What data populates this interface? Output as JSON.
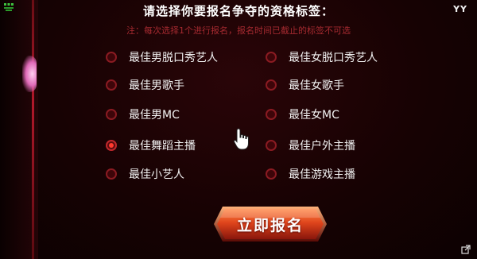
{
  "window": {
    "logo": "YY"
  },
  "form": {
    "title": "请选择你要报名争夺的资格标签：",
    "note": "注：每次选择1个进行报名，报名时间已截止的标签不可选",
    "options": [
      {
        "label": "最佳男脱口秀艺人",
        "selected": false
      },
      {
        "label": "最佳女脱口秀艺人",
        "selected": false
      },
      {
        "label": "最佳男歌手",
        "selected": false
      },
      {
        "label": "最佳女歌手",
        "selected": false
      },
      {
        "label": "最佳男MC",
        "selected": false
      },
      {
        "label": "最佳女MC",
        "selected": false
      },
      {
        "label": "最佳舞蹈主播",
        "selected": true
      },
      {
        "label": "最佳户外主播",
        "selected": false
      },
      {
        "label": "最佳小艺人",
        "selected": false
      },
      {
        "label": "最佳游戏主播",
        "selected": false
      }
    ],
    "submit_label": "立即报名"
  },
  "icons": {
    "top_left": "app-menu-icon",
    "cursor": "hand-pointer-icon",
    "bottom_right": "external-link-icon"
  },
  "colors": {
    "background": "#170203",
    "accent_red": "#c0282c",
    "note_red": "#a62a30",
    "button_orange": "#e0451c"
  }
}
